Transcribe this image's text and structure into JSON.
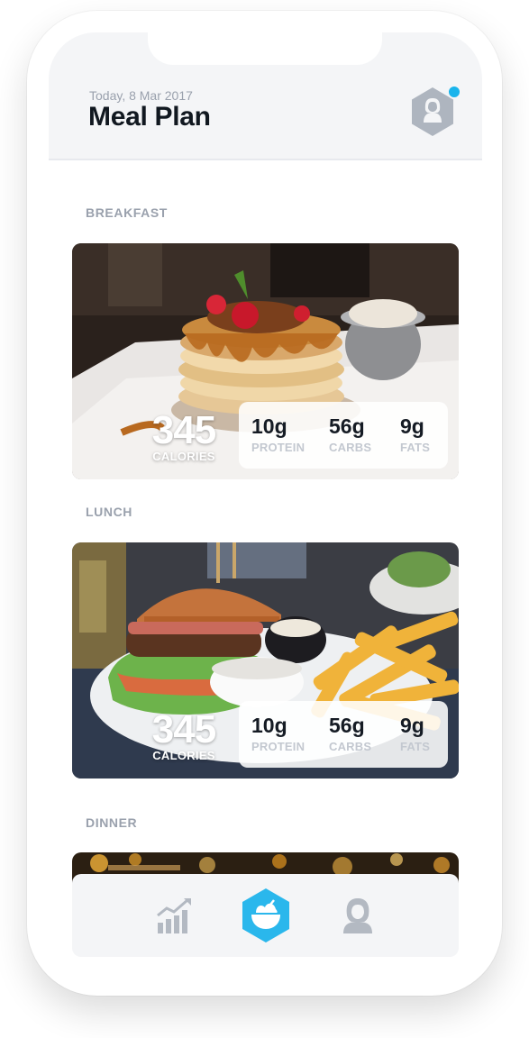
{
  "header": {
    "date": "Today, 8 Mar 2017",
    "title": "Meal Plan",
    "profile_icon": "user-hexagon-icon",
    "notification_dot_color": "#19b4ec"
  },
  "meals": [
    {
      "label": "BREAKFAST",
      "photo": "pancakes",
      "calories": "345",
      "calories_label": "CALORIES",
      "macros": [
        {
          "value": "10g",
          "label": "PROTEIN"
        },
        {
          "value": "56g",
          "label": "CARBS"
        },
        {
          "value": "9g",
          "label": "FATS"
        }
      ]
    },
    {
      "label": "LUNCH",
      "photo": "burger-and-fries",
      "calories": "345",
      "calories_label": "CALORIES",
      "macros": [
        {
          "value": "10g",
          "label": "PROTEIN"
        },
        {
          "value": "56g",
          "label": "CARBS"
        },
        {
          "value": "9g",
          "label": "FATS"
        }
      ]
    },
    {
      "label": "DINNER",
      "photo": "dinner-lights"
    }
  ],
  "tabbar": {
    "tabs": [
      {
        "icon": "stats-chart-icon",
        "active": false
      },
      {
        "icon": "salad-bowl-icon",
        "active": true
      },
      {
        "icon": "profile-icon",
        "active": false
      }
    ],
    "active_color": "#2ab7ec",
    "inactive_color": "#b3b9c2"
  }
}
